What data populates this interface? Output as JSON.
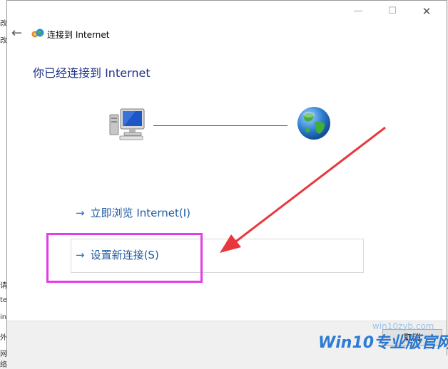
{
  "background": {
    "fragments": [
      "改",
      "改",
      "请",
      "te",
      "in",
      "外",
      "网络"
    ]
  },
  "window": {
    "min_glyph": "—",
    "max_glyph": "☐",
    "close_glyph": "✕"
  },
  "header": {
    "back_glyph": "←",
    "title": "连接到 Internet"
  },
  "main": {
    "heading": "你已经连接到 Internet"
  },
  "links": {
    "browse": {
      "arrow": "→",
      "label": "立即浏览 Internet(I)"
    },
    "setup": {
      "arrow": "→",
      "label": "设置新连接(S)"
    }
  },
  "footer": {
    "cancel_label": "取消"
  },
  "watermark": {
    "url": "win10zyb.com",
    "brand": "Win10",
    "brand_cn": "专业版官网"
  },
  "colors": {
    "heading": "#1e3287",
    "link": "#1e5aa0",
    "highlight_border": "#e23de6",
    "annotation_arrow": "#e8383d"
  },
  "icons": {
    "header": "network-connection-icon",
    "computer": "computer-monitor-icon",
    "internet": "globe-icon"
  }
}
